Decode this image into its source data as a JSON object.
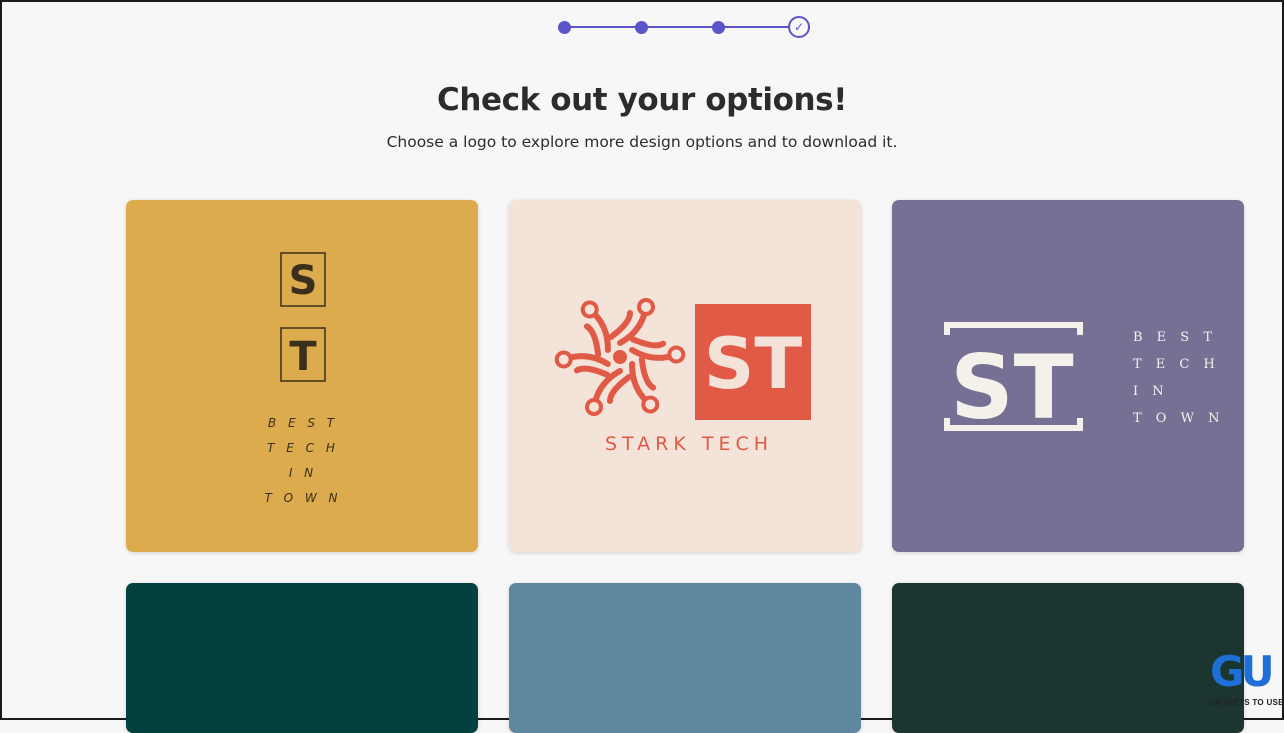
{
  "stepper": {
    "total_steps": 4,
    "completed_steps": 3,
    "current_step": 4
  },
  "header": {
    "title": "Check out your options!",
    "subtitle": "Choose a logo to explore more design options and to download it."
  },
  "logos": [
    {
      "bg": "#dcab4d",
      "ink": "#3a2f1c",
      "letters": [
        "S",
        "T"
      ],
      "tagline": [
        "B E S T",
        "T E C H",
        "I N",
        "T O W N"
      ]
    },
    {
      "bg": "#f3e3d9",
      "ink": "#e05a46",
      "monogram": "ST",
      "brand": "STARK TECH"
    },
    {
      "bg": "#767095",
      "ink": "#f4f1ea",
      "monogram": "ST",
      "tagline": [
        "B E S T",
        "T E C H",
        "I N",
        "T O W N"
      ]
    },
    {
      "bg": "#014241"
    },
    {
      "bg": "#5f88a0"
    },
    {
      "bg": "#1b3630"
    }
  ],
  "watermark": {
    "text": "GADGETS TO USE",
    "mark": "GU"
  },
  "colors": {
    "accent": "#5a55c9",
    "background": "#f7f7f7",
    "text": "#2c2c2c"
  }
}
